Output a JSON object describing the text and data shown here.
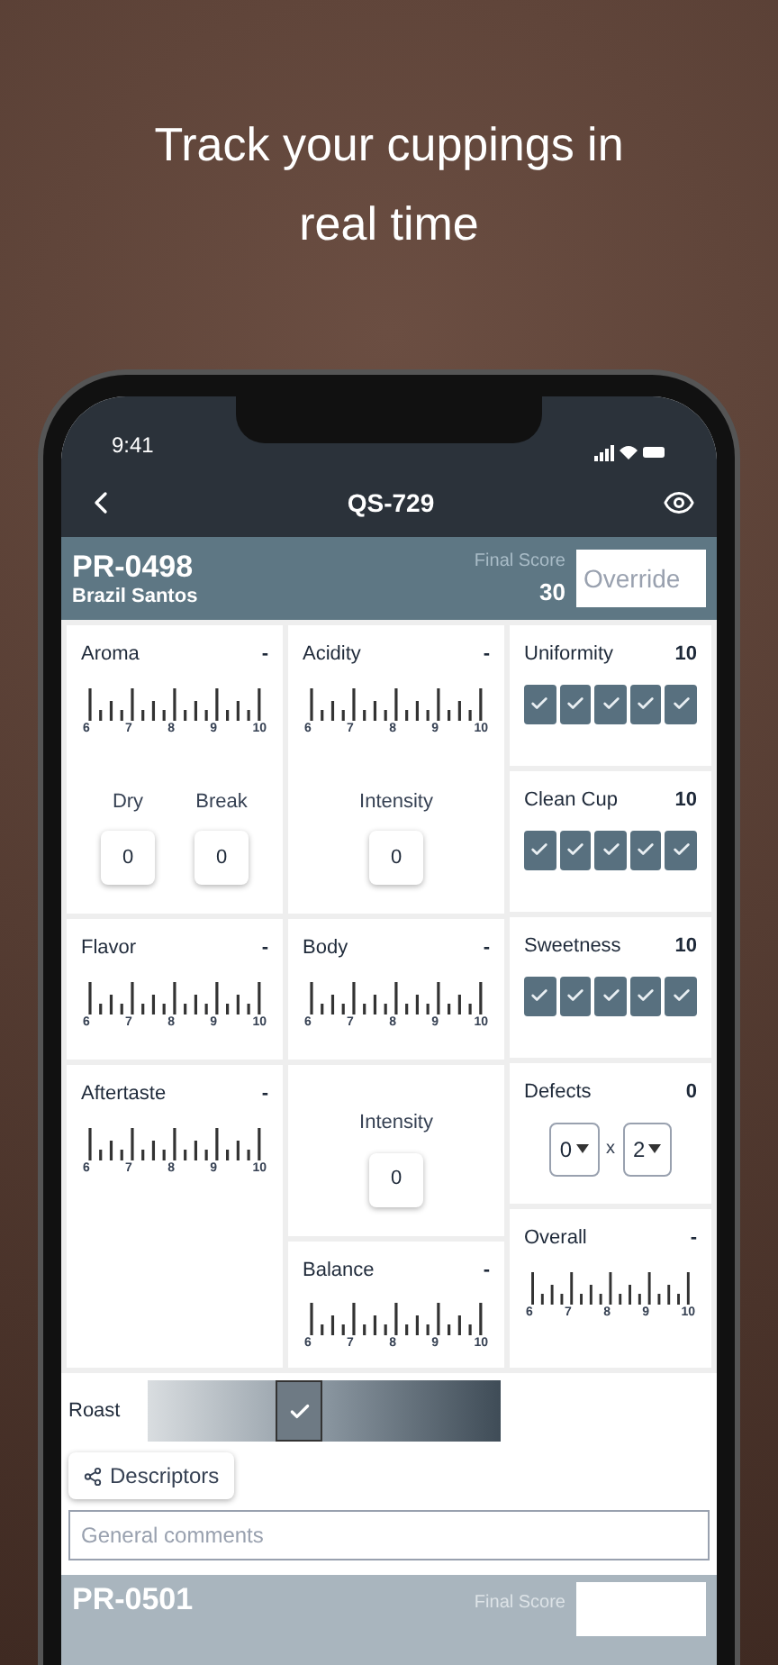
{
  "headline": "Track your cuppings in real time",
  "status_bar": {
    "time": "9:41"
  },
  "nav": {
    "title": "QS-729"
  },
  "sample": {
    "code": "PR-0498",
    "name": "Brazil Santos",
    "score_label": "Final Score",
    "score": "30",
    "override_placeholder": "Override"
  },
  "columns": [
    [
      {
        "kind": "scale",
        "label": "Aroma",
        "value": "-",
        "ticks": [
          "6",
          "7",
          "8",
          "9",
          "10"
        ],
        "inputs": [
          {
            "label": "Dry",
            "value": "0"
          },
          {
            "label": "Break",
            "value": "0"
          }
        ]
      },
      {
        "kind": "scale",
        "label": "Flavor",
        "value": "-",
        "ticks": [
          "6",
          "7",
          "8",
          "9",
          "10"
        ]
      },
      {
        "kind": "scale",
        "label": "Aftertaste",
        "value": "-",
        "ticks": [
          "6",
          "7",
          "8",
          "9",
          "10"
        ]
      }
    ],
    [
      {
        "kind": "scale",
        "label": "Acidity",
        "value": "-",
        "ticks": [
          "6",
          "7",
          "8",
          "9",
          "10"
        ],
        "inputs": [
          {
            "label": "Intensity",
            "value": "0"
          }
        ]
      },
      {
        "kind": "scale",
        "label": "Body",
        "value": "-",
        "ticks": [
          "6",
          "7",
          "8",
          "9",
          "10"
        ]
      },
      {
        "kind": "inputs",
        "inputs": [
          {
            "label": "Intensity",
            "value": "0"
          }
        ]
      },
      {
        "kind": "scale",
        "label": "Balance",
        "value": "-",
        "ticks": [
          "6",
          "7",
          "8",
          "9",
          "10"
        ]
      }
    ],
    [
      {
        "kind": "checks",
        "label": "Uniformity",
        "value": "10",
        "boxes": [
          {
            "checked": true
          },
          {
            "checked": true
          },
          {
            "checked": true
          },
          {
            "checked": true
          },
          {
            "checked": true
          }
        ]
      },
      {
        "kind": "checks",
        "label": "Clean Cup",
        "value": "10",
        "boxes": [
          {
            "checked": true
          },
          {
            "checked": true
          },
          {
            "checked": true
          },
          {
            "checked": true
          },
          {
            "checked": true
          }
        ]
      },
      {
        "kind": "checks",
        "label": "Sweetness",
        "value": "10",
        "boxes": [
          {
            "checked": true
          },
          {
            "checked": true
          },
          {
            "checked": true
          },
          {
            "checked": true
          },
          {
            "checked": true
          }
        ]
      },
      {
        "kind": "defects",
        "label": "Defects",
        "value": "0",
        "cups": "0",
        "operator": "x",
        "intensity": "2"
      },
      {
        "kind": "scale",
        "label": "Overall",
        "value": "-",
        "ticks": [
          "6",
          "7",
          "8",
          "9",
          "10"
        ]
      }
    ]
  ],
  "roast": {
    "label": "Roast",
    "level": 0.43
  },
  "descriptors_button": "Descriptors",
  "comments": {
    "placeholder": "General comments"
  },
  "next_sample": {
    "code": "PR-0501",
    "score_label": "Final Score"
  }
}
